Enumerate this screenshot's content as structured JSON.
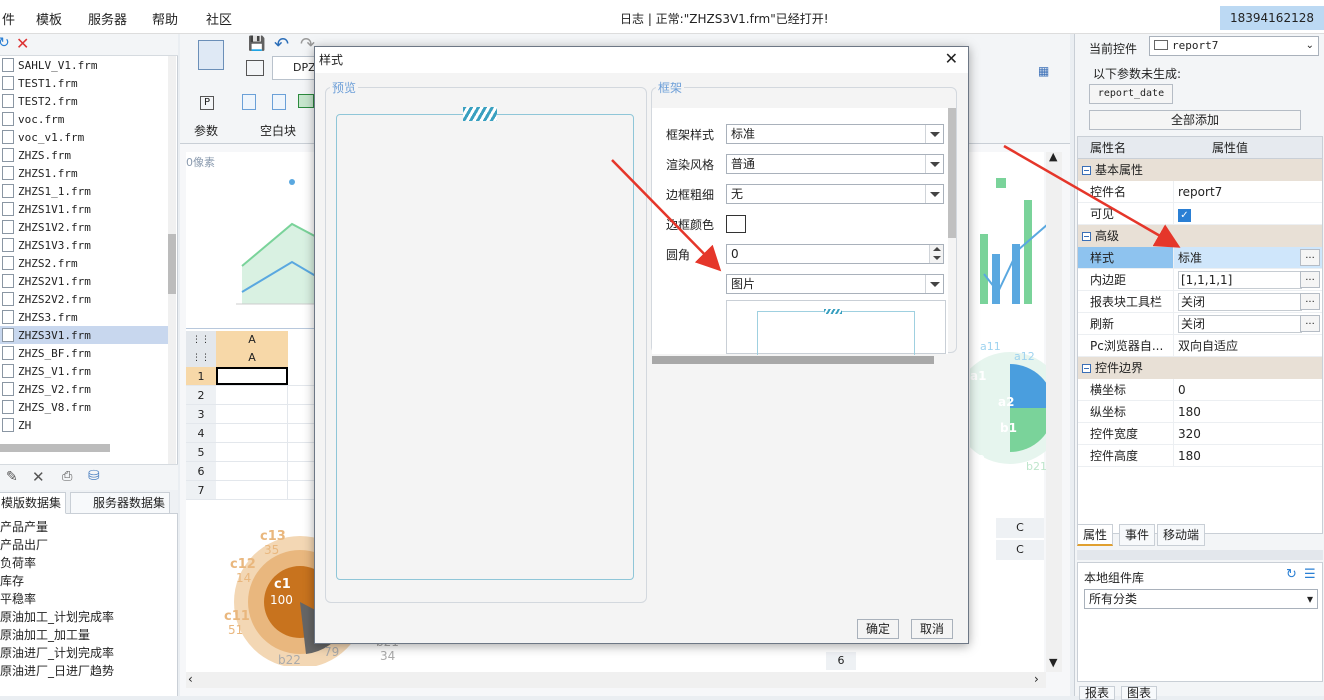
{
  "menubar": {
    "items": [
      "件",
      "模板",
      "服务器",
      "帮助",
      "社区"
    ],
    "status_text": "日志 | 正常:\"ZHZS3V1.frm\"已经打开!",
    "user": "18394162128"
  },
  "file_list": {
    "items": [
      "SAHLV_V1.frm",
      "TEST1.frm",
      "TEST2.frm",
      "voc.frm",
      "voc_v1.frm",
      "ZHZS.frm",
      "ZHZS1.frm",
      "ZHZS1_1.frm",
      "ZHZS1V1.frm",
      "ZHZS1V2.frm",
      "ZHZS1V3.frm",
      "ZHZS2.frm",
      "ZHZS2V1.frm",
      "ZHZS2V2.frm",
      "ZHZS3.frm",
      "ZHZS3V1.frm",
      "ZHZS_BF.frm",
      "ZHZS_V1.frm",
      "ZHZS_V2.frm",
      "ZHZS_V8.frm",
      "ZH"
    ],
    "selected": "ZHZS3V1.frm"
  },
  "datasets": {
    "tabs": [
      "模版数据集",
      "服务器数据集"
    ],
    "items": [
      "产品产量",
      "产品出厂",
      "负荷率",
      "库存",
      "平稳率",
      "原油加工_计划完成率",
      "原油加工_加工量",
      "原油进厂_计划完成率",
      "原油进厂_日进厂趋势"
    ]
  },
  "center": {
    "tab_label": "DPZ",
    "toolbar": {
      "param": "参数",
      "blank": "空白块"
    },
    "canvas_label": "0像素",
    "grid": {
      "col_header": "A",
      "rows": [
        "1",
        "2",
        "3",
        "4",
        "5",
        "6",
        "7"
      ]
    },
    "pie_labels": [
      {
        "name": "c13",
        "value": "35"
      },
      {
        "name": "c12",
        "value": "14"
      },
      {
        "name": "c1",
        "value": "100"
      },
      {
        "name": "c11",
        "value": "51"
      },
      {
        "name": "b22",
        "value": ""
      },
      {
        "name": "b21",
        "value": "34"
      },
      {
        "name": "",
        "value": "79"
      }
    ],
    "right_pie_labels": [
      "a11",
      "a12",
      "a1",
      "a2",
      "b1",
      "b21",
      "b2"
    ],
    "right_table": {
      "col": "C",
      "rows": [
        "6"
      ]
    }
  },
  "dialog": {
    "title": "样式",
    "preview_legend": "预览",
    "frame_legend": "框架",
    "fields": [
      {
        "label": "框架样式",
        "value": "标准",
        "type": "combo"
      },
      {
        "label": "渲染风格",
        "value": "普通",
        "type": "combo"
      },
      {
        "label": "边框粗细",
        "value": "无",
        "type": "combo"
      },
      {
        "label": "边框颜色",
        "value": "",
        "type": "color"
      },
      {
        "label": "圆角",
        "value": "0",
        "type": "spin"
      }
    ],
    "bg_type": "图片",
    "ok": "确定",
    "cancel": "取消"
  },
  "right_panel": {
    "current_control_label": "当前控件",
    "current_control": "report7",
    "not_generated": "以下参数未生成:",
    "param_chip": "report_date",
    "add_all": "全部添加",
    "header": {
      "name": "属性名",
      "value": "属性值"
    },
    "groups": [
      {
        "title": "基本属性",
        "rows": [
          {
            "name": "控件名",
            "value": "report7"
          },
          {
            "name": "可见",
            "value": "✓"
          }
        ]
      },
      {
        "title": "高级",
        "rows": [
          {
            "name": "样式",
            "value": "标准"
          },
          {
            "name": "内边距",
            "value": "[1,1,1,1]"
          },
          {
            "name": "报表块工具栏",
            "value": "关闭"
          },
          {
            "name": "刷新",
            "value": "关闭"
          },
          {
            "name": "Pc浏览器自...",
            "value": "双向自适应"
          }
        ]
      },
      {
        "title": "控件边界",
        "rows": [
          {
            "name": "横坐标",
            "value": "0"
          },
          {
            "name": "纵坐标",
            "value": "180"
          },
          {
            "name": "控件宽度",
            "value": "320"
          },
          {
            "name": "控件高度",
            "value": "180"
          }
        ]
      }
    ],
    "tabs": [
      "属性",
      "事件",
      "移动端"
    ],
    "lib_label": "本地组件库",
    "lib_category": "所有分类",
    "bottom_tabs": [
      "报表",
      "图表"
    ]
  },
  "colors": {
    "accent": "#6d9fd8",
    "annotation_arrow": "#e5362a",
    "selected_row": "#8ec3ef"
  }
}
